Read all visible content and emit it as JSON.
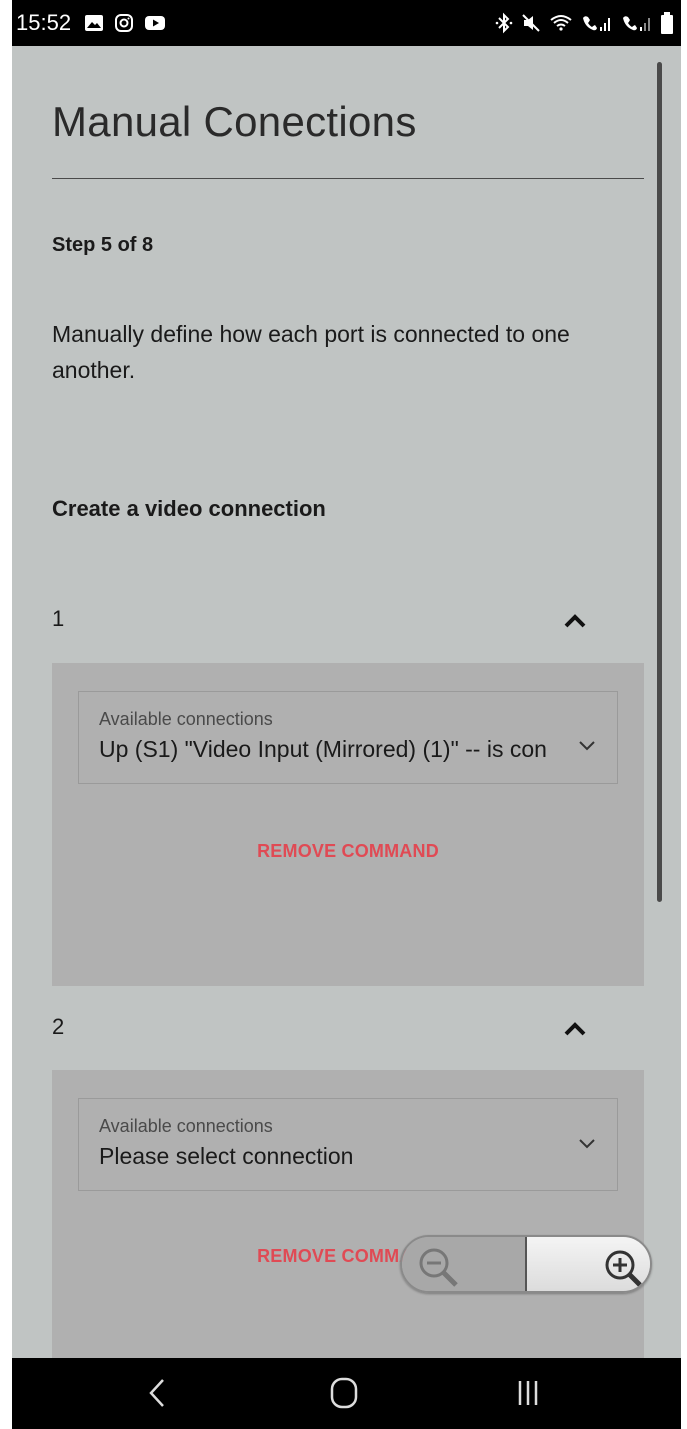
{
  "status_bar": {
    "time": "15:52",
    "left_icons": [
      "gallery-icon",
      "instagram-icon",
      "youtube-icon"
    ],
    "right_icons": [
      "bluetooth-icon",
      "mute-icon",
      "wifi-calling-icon",
      "signal-sim1-icon",
      "signal-sim2-icon",
      "battery-icon"
    ]
  },
  "page": {
    "title": "Manual Conections",
    "step": "Step 5 of 8",
    "description": "Manually define how each port is connected to one another.",
    "section_heading": "Create a video connection"
  },
  "commands": [
    {
      "number": "1",
      "select_label": "Available connections",
      "select_value": "Up (S1) \"Video Input (Mirrored) (1)\" -- is con",
      "remove_label": "REMOVE COMMAND"
    },
    {
      "number": "2",
      "select_label": "Available connections",
      "select_value": "Please select connection",
      "remove_label": "REMOVE COMMAND"
    }
  ],
  "zoom": {
    "out_icon": "zoom-out-icon",
    "in_icon": "zoom-in-icon"
  },
  "nav": {
    "back_icon": "back-icon",
    "home_icon": "home-icon",
    "recents_icon": "recents-icon"
  },
  "colors": {
    "background": "#c0c4c3",
    "panel": "#b0b0b0",
    "remove_accent": "#e04a54",
    "system_bar": "#000000"
  }
}
